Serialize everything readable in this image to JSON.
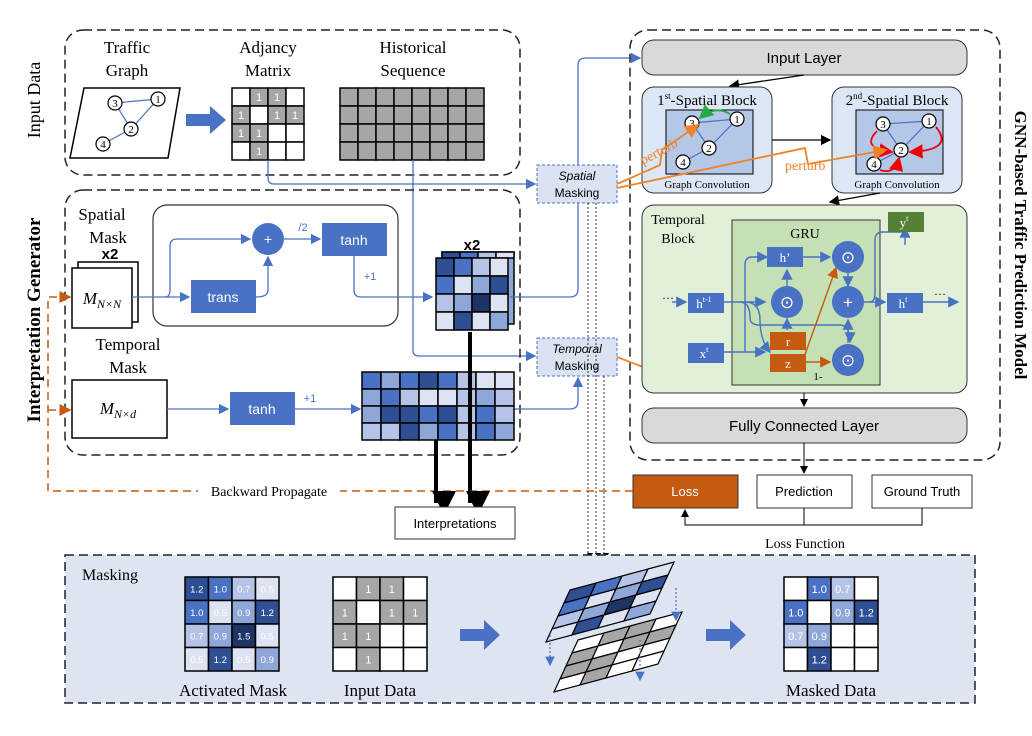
{
  "colors": {
    "blue": "#4a72c4",
    "orange": "#c55a11",
    "orange_line": "#f0822a",
    "green_box": "#e2efd9",
    "gru_box": "#c5e0b4",
    "spatial_box": "#dbe7f5",
    "gray_cell": "#a6a6a6",
    "masking_bg": "#dee4f2",
    "yt_green": "#548235"
  },
  "input_data": {
    "label": "Input Data",
    "traffic_graph": {
      "title1": "Traffic",
      "title2": "Graph",
      "nodes": [
        "1",
        "2",
        "3",
        "4"
      ]
    },
    "adjacency": {
      "title1": "Adjancy",
      "title2": "Matrix",
      "matrix": [
        [
          0,
          1,
          1,
          0
        ],
        [
          1,
          0,
          1,
          1
        ],
        [
          1,
          1,
          0,
          0
        ],
        [
          0,
          1,
          0,
          0
        ]
      ],
      "cell_text": "1"
    },
    "historical": {
      "title1": "Historical",
      "title2": "Sequence",
      "rows": 4,
      "cols": 8
    }
  },
  "generator": {
    "label": "Interpretation Generator",
    "spatial_mask": {
      "title1": "Spatial",
      "title2": "Mask",
      "count": "x2",
      "symbol": "M",
      "sub": "N×N"
    },
    "plus": "+",
    "half": "/2",
    "tanh": "tanh",
    "trans": "trans",
    "plus_one": "+1",
    "temporal_mask": {
      "title1": "Temporal",
      "title2": "Mask",
      "symbol": "M",
      "sub": "N×d"
    },
    "spatial_heat_count": "x2",
    "spatial_heat": [
      [
        4,
        3,
        1,
        0
      ],
      [
        3,
        0,
        2,
        4
      ],
      [
        1,
        2,
        5,
        0
      ],
      [
        0,
        4,
        0,
        2
      ]
    ],
    "temporal_heat": [
      [
        3,
        2,
        3,
        4,
        3,
        1,
        0,
        0
      ],
      [
        2,
        3,
        1,
        0,
        0,
        1,
        2,
        1
      ],
      [
        2,
        4,
        4,
        3,
        4,
        1,
        3,
        1
      ],
      [
        1,
        1,
        4,
        2,
        3,
        1,
        3,
        2
      ]
    ]
  },
  "masking_nodes": {
    "spatial": {
      "line1": "Spatial",
      "line2": "Masking"
    },
    "temporal": {
      "line1": "Temporal",
      "line2": "Masking"
    }
  },
  "model": {
    "title": "GNN-based Traffic Prediction Model",
    "input_layer": "Input Layer",
    "block1": {
      "title_pre": "1",
      "title_sup": "st",
      "title_post": "-Spatial Block",
      "caption": "Graph Convolution"
    },
    "block2": {
      "title_pre": "2",
      "title_sup": "nd",
      "title_post": "-Spatial Block",
      "caption": "Graph Convolution"
    },
    "perturb": "perturb",
    "temporal_block": {
      "title1": "Temporal",
      "title2": "Block",
      "gru": "GRU",
      "h_prime": "h’",
      "h_prev": "h",
      "h_prev_sup": "t-1",
      "h_t": "h",
      "h_t_sup": "t",
      "x_t": "x",
      "x_t_sup": "t",
      "y_t": "y",
      "y_t_sup": "t",
      "r": "r",
      "z": "z",
      "one_minus": "1-",
      "dots": "···",
      "odot": "⊙",
      "plus": "+"
    },
    "fc_layer": "Fully Connected Layer"
  },
  "loss": {
    "loss": "Loss",
    "prediction": "Prediction",
    "ground_truth": "Ground Truth",
    "loss_function": "Loss Function",
    "backward": "Backward Propagate"
  },
  "interpretations": "Interpretations",
  "masking_panel": {
    "title": "Masking",
    "activated_label": "Activated Mask",
    "input_label": "Input Data",
    "masked_label": "Masked Data",
    "activated": [
      [
        "1.2",
        "1.0",
        "0.7",
        "0.5"
      ],
      [
        "1.0",
        "0.5",
        "0.9",
        "1.2"
      ],
      [
        "0.7",
        "0.9",
        "1.5",
        "0.5"
      ],
      [
        "0.5",
        "1.2",
        "0.5",
        "0.9"
      ]
    ],
    "input": [
      [
        0,
        1,
        1,
        0
      ],
      [
        1,
        0,
        1,
        1
      ],
      [
        1,
        1,
        0,
        0
      ],
      [
        0,
        1,
        0,
        0
      ]
    ],
    "one": "1"
  }
}
